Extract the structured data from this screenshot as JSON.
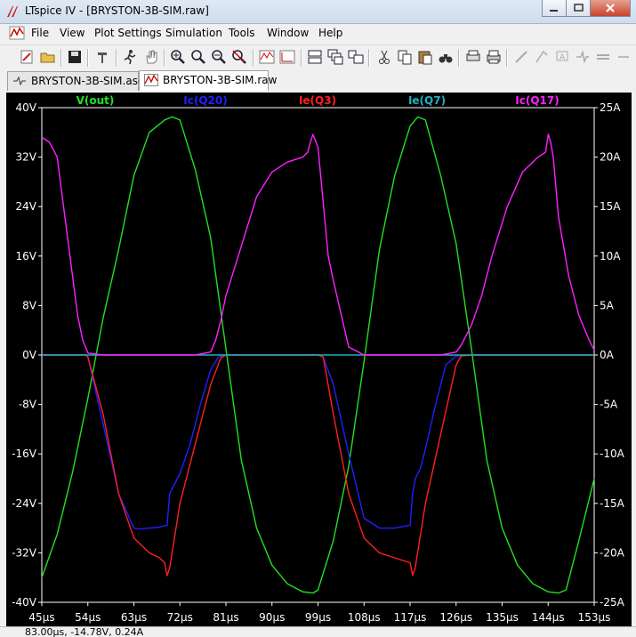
{
  "window": {
    "app_name": "LTspice IV",
    "doc_name": "[BRYSTON-3B-SIM.raw]"
  },
  "menu": [
    "File",
    "View",
    "Plot Settings",
    "Simulation",
    "Tools",
    "Window",
    "Help"
  ],
  "tabs": [
    {
      "label": "BRYSTON-3B-SIM.asc",
      "icon": "schematic-icon",
      "active": false
    },
    {
      "label": "BRYSTON-3B-SIM.raw",
      "icon": "waveform-icon",
      "active": true
    }
  ],
  "status": {
    "text": "83.00μs, -14.78V, 0.24A"
  },
  "chart_data": {
    "type": "line",
    "x_ticks": [
      "45μs",
      "54μs",
      "63μs",
      "72μs",
      "81μs",
      "90μs",
      "99μs",
      "108μs",
      "117μs",
      "126μs",
      "135μs",
      "144μs",
      "153μs"
    ],
    "y_left_ticks": [
      "40V",
      "32V",
      "24V",
      "16V",
      "8V",
      "0V",
      "-8V",
      "-16V",
      "-24V",
      "-32V",
      "-40V"
    ],
    "y_right_ticks": [
      "25A",
      "20A",
      "15A",
      "10A",
      "5A",
      "0A",
      "-5A",
      "-10A",
      "-15A",
      "-20A",
      "-25A"
    ],
    "xlim": [
      45,
      153
    ],
    "ylim_left": [
      -40,
      40
    ],
    "ylim_right": [
      -25,
      25
    ],
    "background": "#000000",
    "axis_color": "#ffffff",
    "series": [
      {
        "name": "V(out)",
        "axis": "left",
        "color": "#22e022",
        "x": [
          45,
          48,
          51,
          54,
          57,
          60,
          63,
          66,
          69,
          70.5,
          72,
          75,
          78,
          81,
          84,
          87,
          90,
          93,
          96,
          98,
          99,
          102,
          105,
          108,
          111,
          114,
          117,
          118.5,
          120,
          123,
          126,
          129,
          132,
          135,
          138,
          141,
          144,
          146,
          147.5,
          150,
          153
        ],
        "y": [
          -36,
          -29,
          -19,
          -7,
          6,
          17,
          29,
          36,
          38,
          38.5,
          38,
          30,
          19,
          1,
          -17,
          -28,
          -34,
          -37,
          -38.3,
          -38.5,
          -38,
          -30,
          -18,
          -1,
          17,
          29,
          37,
          38.5,
          38,
          29,
          18,
          1,
          -17,
          -28,
          -34,
          -37,
          -38.3,
          -38.5,
          -38,
          -30,
          -20
        ]
      },
      {
        "name": "Ic(Q20)",
        "axis": "right",
        "color": "#2020ff",
        "x": [
          45,
          48,
          51,
          53.5,
          54,
          57,
          60,
          63,
          64,
          66,
          68,
          69.5,
          70,
          71.5,
          72,
          74,
          76,
          78,
          79.5,
          81,
          84,
          87,
          90,
          93,
          96,
          99,
          100,
          102,
          105,
          108,
          111,
          114,
          117,
          117.5,
          118,
          118.5,
          119,
          120,
          122,
          124,
          126,
          129,
          132,
          135,
          138,
          141,
          144,
          147,
          150,
          153
        ],
        "y": [
          0,
          0,
          0,
          0,
          -0.2,
          -7,
          -14,
          -17.5,
          -17.6,
          -17.5,
          -17.4,
          -17.2,
          -14,
          -12.5,
          -12,
          -9,
          -5,
          -1.5,
          -0.2,
          0,
          0,
          0,
          0,
          0,
          0,
          0,
          -0.2,
          -3,
          -10,
          -16.5,
          -17.5,
          -17.5,
          -17.2,
          -14,
          -12.5,
          -12,
          -11.5,
          -9.5,
          -5,
          -1,
          -0.1,
          0,
          0,
          0,
          0,
          0,
          0,
          0,
          0,
          0
        ]
      },
      {
        "name": "Ie(Q3)",
        "axis": "right",
        "color": "#ff2020",
        "x": [
          45,
          48,
          51,
          53.5,
          54,
          57,
          60,
          63,
          66,
          68,
          69,
          69.5,
          70,
          72,
          75,
          78,
          80,
          81,
          84,
          87,
          90,
          93,
          96,
          99,
          100,
          102,
          105,
          108,
          111,
          114,
          117,
          117.5,
          118,
          120,
          123,
          126,
          127,
          129,
          132,
          135,
          138,
          141,
          144,
          147,
          150,
          153
        ],
        "y": [
          0,
          0,
          0,
          0,
          -0.2,
          -6,
          -14,
          -18.5,
          -20,
          -20.5,
          -21,
          -22.3,
          -21.5,
          -15,
          -9,
          -3,
          -0.3,
          0,
          0,
          0,
          0,
          0,
          0,
          0,
          -0.2,
          -6,
          -14,
          -18.5,
          -20,
          -20.5,
          -21,
          -22.3,
          -21.5,
          -15,
          -8,
          -1,
          -0.1,
          0,
          0,
          0,
          0,
          0,
          0,
          0,
          0,
          0
        ]
      },
      {
        "name": "Ie(Q7)",
        "axis": "right",
        "color": "#20b0c0",
        "x": [
          45,
          46,
          47,
          48,
          49,
          50,
          51,
          52,
          53,
          53.5,
          54,
          57,
          60,
          63,
          66,
          69,
          72,
          75,
          78,
          81,
          82,
          84,
          86,
          87,
          88,
          90,
          93,
          95,
          96.5,
          97,
          97.5,
          98,
          99,
          100,
          101,
          102,
          105,
          108,
          111,
          114,
          117,
          120,
          123,
          126,
          128,
          130,
          132,
          134,
          136,
          138,
          140,
          142,
          143,
          144,
          145,
          146,
          147,
          148,
          150,
          152,
          153
        ],
        "y": [
          0,
          0,
          0,
          0,
          0,
          0,
          0,
          0,
          0,
          0,
          0,
          0,
          0,
          0,
          0,
          0,
          0,
          0,
          0,
          0,
          0,
          0,
          0,
          0,
          0,
          0,
          0,
          0,
          0,
          0,
          0,
          0,
          0,
          0,
          0,
          0,
          0,
          0,
          0,
          0,
          0,
          0,
          0,
          0,
          0,
          0,
          0,
          0,
          0,
          0,
          0,
          0,
          0,
          0,
          0,
          0,
          0,
          0,
          0,
          0,
          0
        ]
      },
      {
        "name": "Ic(Q17)",
        "axis": "right",
        "color": "#ff20ff",
        "x": [
          45,
          46.5,
          48,
          49,
          50,
          51,
          52,
          53,
          54,
          57,
          60,
          63,
          66,
          69,
          72,
          75,
          78,
          79,
          80,
          81,
          84,
          87,
          90,
          93,
          96,
          97,
          97.5,
          98,
          99,
          101,
          102,
          105,
          108,
          111,
          114,
          117,
          120,
          123,
          126,
          127,
          129,
          131,
          133,
          136,
          139,
          142,
          143.5,
          144,
          144.5,
          145,
          146,
          148,
          150,
          152,
          153
        ],
        "y": [
          22,
          21.5,
          20,
          16,
          12,
          8,
          4,
          1.5,
          0.2,
          0,
          0,
          0,
          0,
          0,
          0,
          0,
          0.3,
          1.5,
          3.5,
          6,
          11,
          16,
          18.5,
          19.5,
          20,
          20.5,
          21.5,
          22.3,
          21,
          10,
          7.5,
          0.8,
          0,
          0,
          0,
          0,
          0,
          0,
          0.3,
          1,
          3,
          6,
          10,
          15,
          18.5,
          20,
          20.5,
          22.3,
          21.5,
          20,
          14,
          8,
          4,
          1.5,
          0.5
        ]
      }
    ]
  }
}
